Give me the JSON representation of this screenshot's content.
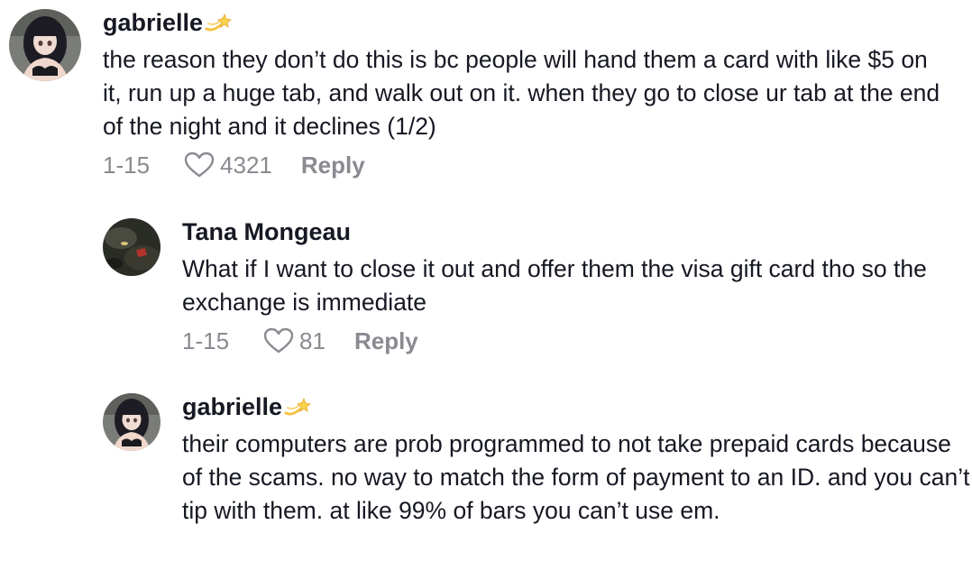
{
  "comments": [
    {
      "username": "gabrielle",
      "badge_icon": "dizzy-star-emoji",
      "text": "the reason they don’t do this is bc people will hand them a card with like $5 on it, run up a huge tab, and walk out on it. when they go to close ur tab at the end of the night and it declines (1/2)",
      "date": "1-15",
      "likes": "4321",
      "reply_label": "Reply"
    },
    {
      "username": "Tana Mongeau",
      "text": "What if I want to close it out and offer them the visa gift card tho so the exchange is immediate",
      "date": "1-15",
      "likes": "81",
      "reply_label": "Reply"
    },
    {
      "username": "gabrielle",
      "badge_icon": "dizzy-star-emoji",
      "text": "their computers are prob programmed to not take prepaid cards because of the scams. no way to match the form of payment to an ID. and you can’t tip with them. at like 99% of bars you can’t use em."
    }
  ],
  "colors": {
    "text": "#161823",
    "meta": "#8a8b91"
  }
}
